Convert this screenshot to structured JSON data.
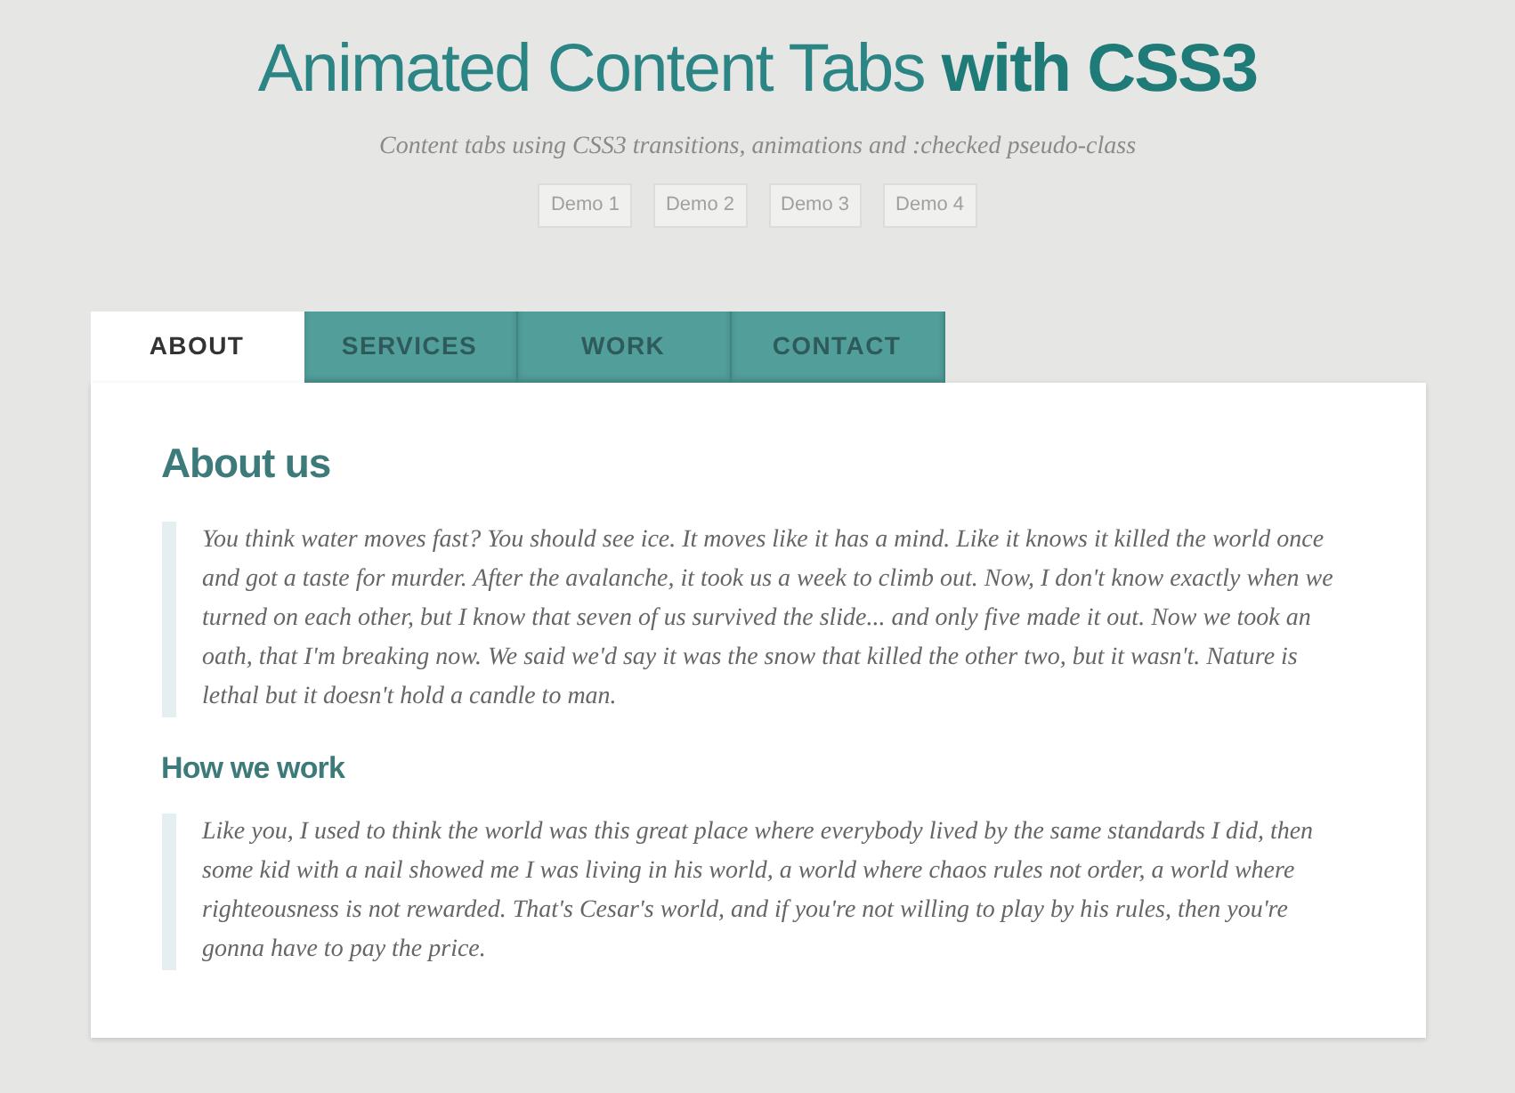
{
  "header": {
    "title": "Animated Content Tabs **with CSS3**",
    "subtitle": "Content tabs using CSS3 transitions, animations and :checked pseudo-class",
    "demos": [
      {
        "label": "Demo 1"
      },
      {
        "label": "Demo 2"
      },
      {
        "label": "Demo 3"
      },
      {
        "label": "Demo 4"
      }
    ]
  },
  "tabs": [
    {
      "label": "ABOUT",
      "selected": true
    },
    {
      "label": "SERVICES",
      "selected": false
    },
    {
      "label": "WORK",
      "selected": false
    },
    {
      "label": "CONTACT",
      "selected": false
    }
  ],
  "content": {
    "sections": [
      {
        "heading": "About us",
        "kind": "main",
        "quote": "You think water moves fast? You should see ice. It moves like it has a mind. Like it knows it killed the world once and got a taste for murder. After the avalanche, it took us a week to climb out. Now, I don't know exactly when we turned on each other, but I know that seven of us survived the slide... and only five made it out. Now we took an oath, that I'm breaking now. We said we'd say it was the snow that killed the other two, but it wasn't. Nature is lethal but it doesn't hold a candle to man."
      },
      {
        "heading": "How we work",
        "kind": "sub",
        "quote": "Like you, I used to think the world was this great place where everybody lived by the same standards I did, then some kid with a nail showed me I was living in his world, a world where chaos rules not order, a world where righteousness is not rewarded. That's Cesar's world, and if you're not willing to play by his rules, then you're gonna have to pay the price."
      }
    ]
  }
}
